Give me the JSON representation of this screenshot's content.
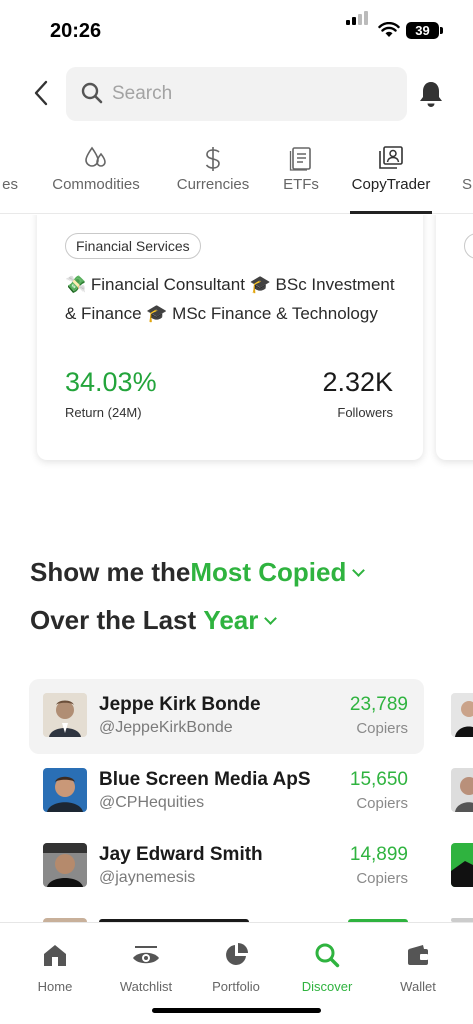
{
  "status_bar": {
    "time": "20:26",
    "battery": "39"
  },
  "search": {
    "placeholder": "Search"
  },
  "tabs": [
    {
      "label": "es",
      "icon": "stocks-icon"
    },
    {
      "label": "Commodities",
      "icon": "droplets-icon"
    },
    {
      "label": "Currencies",
      "icon": "dollar-icon"
    },
    {
      "label": "ETFs",
      "icon": "document-icon"
    },
    {
      "label": "CopyTrader",
      "icon": "copytrader-icon",
      "active": true
    },
    {
      "label": "S",
      "icon": ""
    }
  ],
  "card": {
    "category": "Financial Services",
    "bio": "💸 Financial Consultant 🎓 BSc Investment & Finance 🎓 MSc Finance & Technology",
    "return_value": "34.03%",
    "return_label": "Return (24M)",
    "followers_value": "2.32K",
    "followers_label": "Followers"
  },
  "filter": {
    "line1_prefix": "Show me the",
    "line1_value": "Most Copied",
    "line2_prefix": "Over the Last",
    "line2_value": "Year"
  },
  "traders": [
    {
      "name": "Jeppe Kirk Bonde",
      "handle": "@JeppeKirkBonde",
      "copiers": "23,789",
      "copiers_label": "Copiers"
    },
    {
      "name": "Blue Screen Media ApS",
      "handle": "@CPHequities",
      "copiers": "15,650",
      "copiers_label": "Copiers"
    },
    {
      "name": "Jay Edward Smith",
      "handle": "@jaynemesis",
      "copiers": "14,899",
      "copiers_label": "Copiers"
    }
  ],
  "bottom_nav": [
    {
      "label": "Home",
      "icon": "home-icon"
    },
    {
      "label": "Watchlist",
      "icon": "eye-icon"
    },
    {
      "label": "Portfolio",
      "icon": "pie-chart-icon"
    },
    {
      "label": "Discover",
      "icon": "search-icon",
      "active": true
    },
    {
      "label": "Wallet",
      "icon": "wallet-icon"
    }
  ],
  "colors": {
    "accent_green": "#2fb33f",
    "text_dark": "#1a1a1a"
  }
}
